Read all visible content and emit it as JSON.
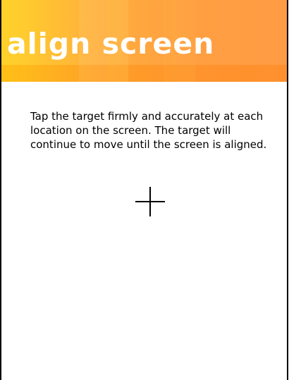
{
  "header": {
    "title": "align screen"
  },
  "instructions": {
    "text": "Tap the target firmly and accurately at each location on the screen. The target will continue to move until the screen is aligned."
  },
  "target": {
    "icon": "crosshair-icon"
  },
  "colors": {
    "header_gradient_start": "#ffcf1c",
    "header_gradient_end": "#ff9539",
    "title_text": "#ffffff",
    "body_text": "#000000",
    "background": "#ffffff",
    "border": "#000000"
  }
}
